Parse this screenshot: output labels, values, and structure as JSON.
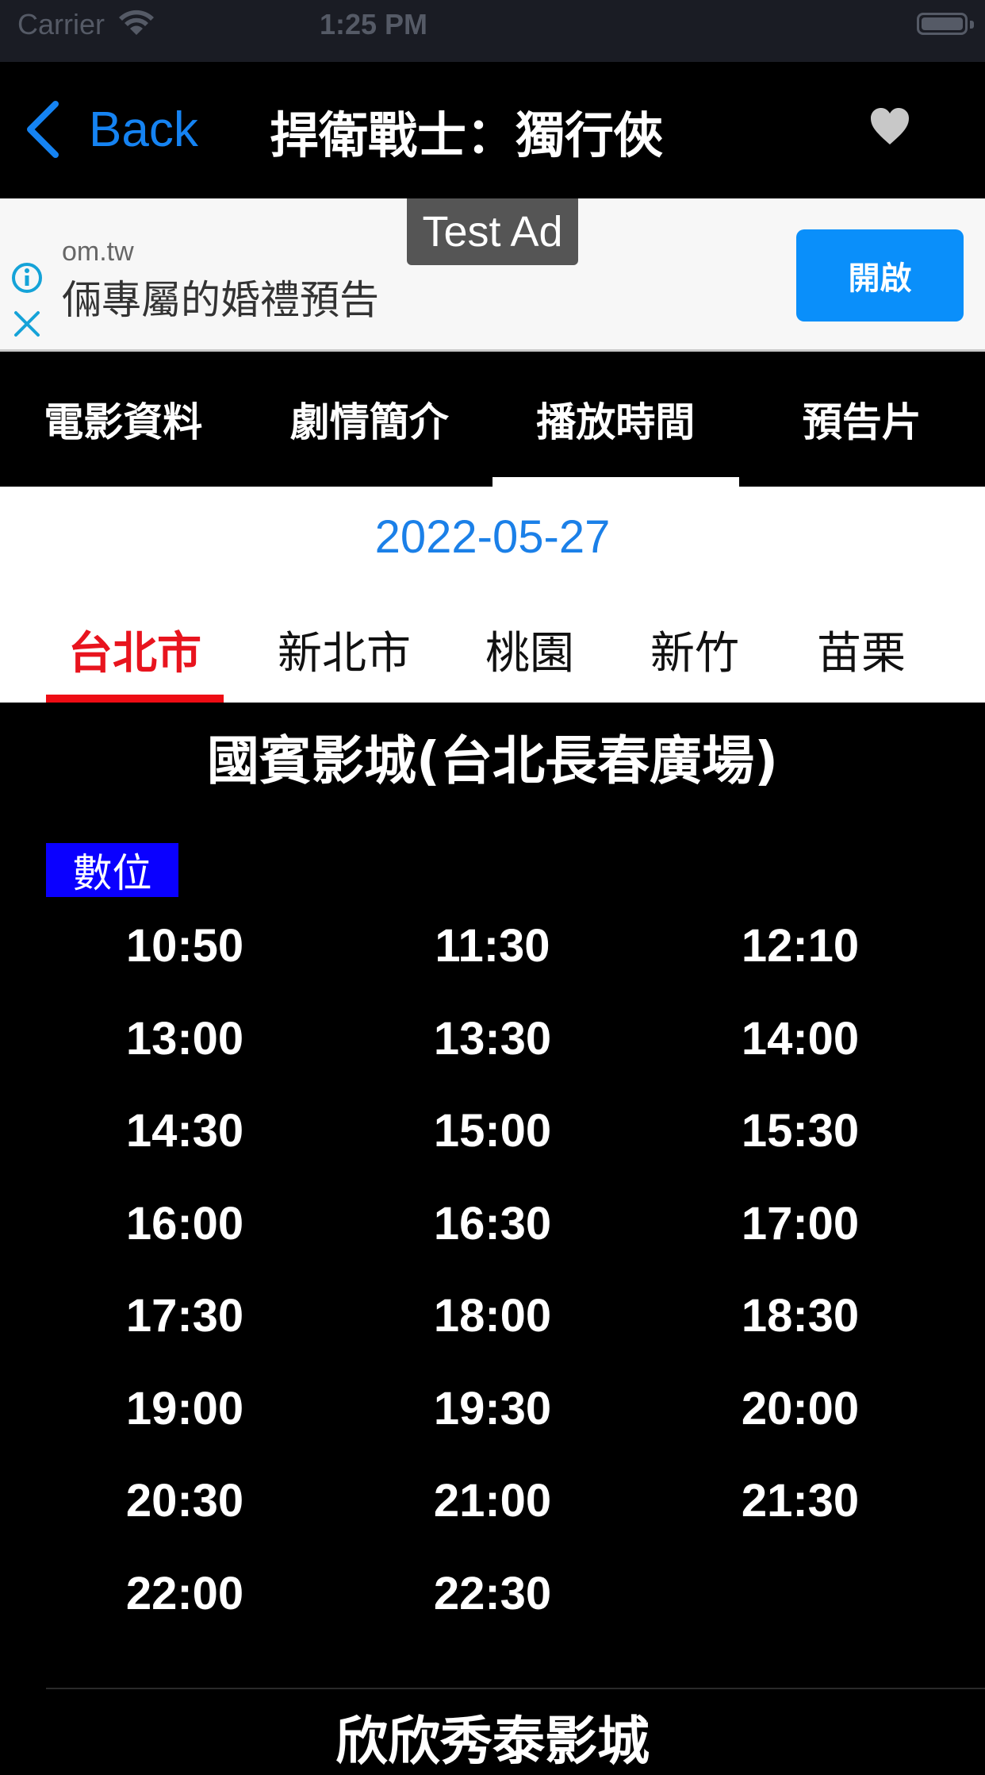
{
  "status_bar": {
    "carrier": "Carrier",
    "time": "1:25 PM"
  },
  "nav": {
    "back_label": "Back",
    "title": "捍衛戰士：獨行俠"
  },
  "ad": {
    "badge": "Test Ad",
    "domain": "om.tw",
    "text": "倆專屬的婚禮預告",
    "button": "開啟"
  },
  "tabs": [
    {
      "label": "電影資料"
    },
    {
      "label": "劇情簡介"
    },
    {
      "label": "播放時間"
    },
    {
      "label": "預告片"
    }
  ],
  "date": "2022-05-27",
  "cities": [
    {
      "label": "台北市"
    },
    {
      "label": "新北市"
    },
    {
      "label": "桃園"
    },
    {
      "label": "新竹"
    },
    {
      "label": "苗栗"
    }
  ],
  "cinema": {
    "name": "國賓影城(台北長春廣場)",
    "format": "數位",
    "showtimes": [
      "10:50",
      "11:30",
      "12:10",
      "13:00",
      "13:30",
      "14:00",
      "14:30",
      "15:00",
      "15:30",
      "16:00",
      "16:30",
      "17:00",
      "17:30",
      "18:00",
      "18:30",
      "19:00",
      "19:30",
      "20:00",
      "20:30",
      "21:00",
      "21:30",
      "22:00",
      "22:30"
    ]
  },
  "next_cinema": "欣欣秀泰影城",
  "colors": {
    "accent_blue": "#1583f2",
    "active_city_red": "#e8141e",
    "format_badge_blue": "#0a00ff",
    "ad_button_blue": "#0a8ffa"
  }
}
